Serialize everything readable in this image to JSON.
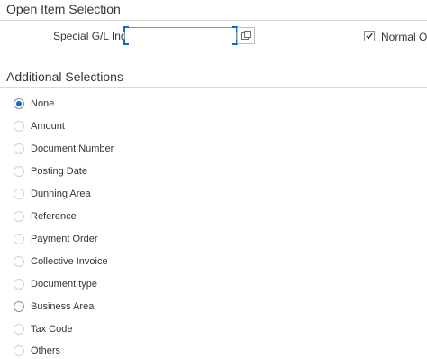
{
  "open_item_section": {
    "title": "Open Item Selection",
    "special_gl_label": "Special G/L Ind:",
    "special_gl_value": "",
    "normal_oi_label": "Normal OI",
    "normal_oi_checked": true
  },
  "additional_section": {
    "title": "Additional Selections",
    "selected": "None",
    "options": [
      {
        "label": "None"
      },
      {
        "label": "Amount"
      },
      {
        "label": "Document Number"
      },
      {
        "label": "Posting Date"
      },
      {
        "label": "Dunning Area"
      },
      {
        "label": "Reference"
      },
      {
        "label": "Payment Order"
      },
      {
        "label": "Collective Invoice"
      },
      {
        "label": "Document type"
      },
      {
        "label": "Business Area"
      },
      {
        "label": "Tax Code"
      },
      {
        "label": "Others"
      }
    ]
  },
  "icons": {
    "value_help": "value-help-icon",
    "checkmark": "checkmark-icon"
  },
  "colors": {
    "accent": "#0a6ed1",
    "text": "#32363a",
    "border": "#89919a"
  }
}
